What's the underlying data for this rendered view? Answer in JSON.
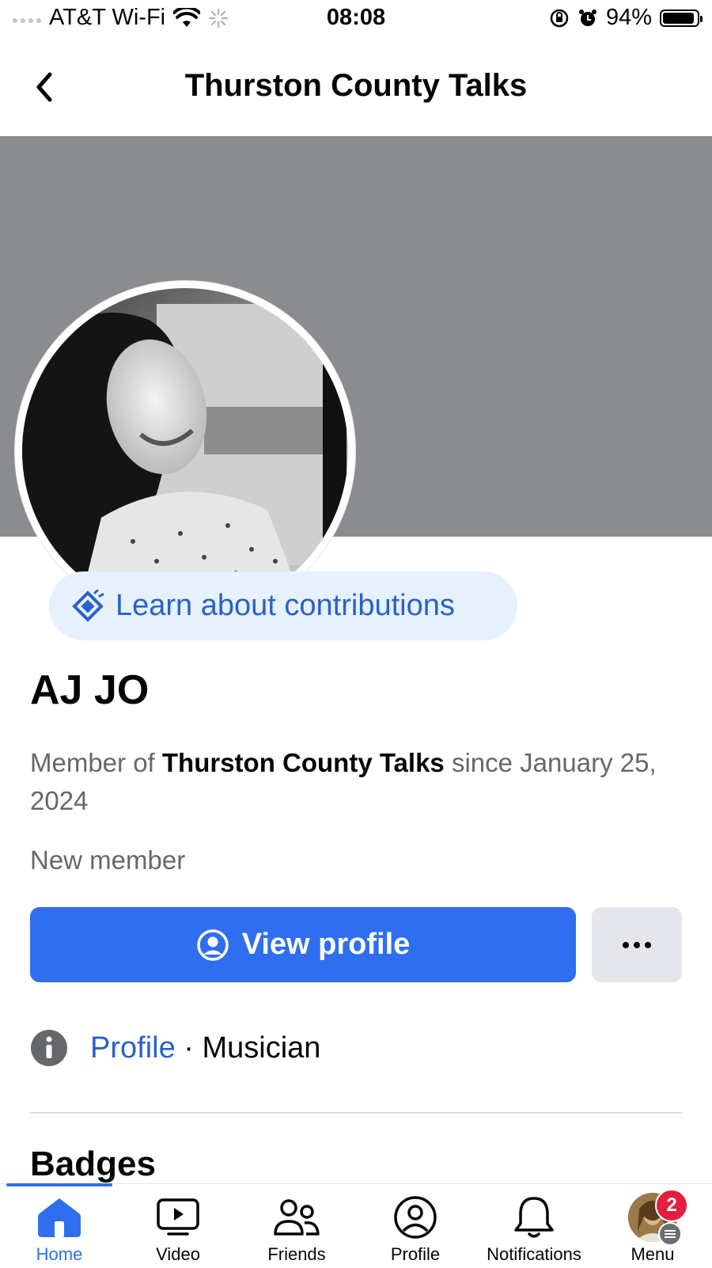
{
  "status_bar": {
    "carrier": "AT&T Wi-Fi",
    "time": "08:08",
    "battery": "94%",
    "battery_level": 0.94
  },
  "header": {
    "title": "Thurston County Talks"
  },
  "contribution_chip": {
    "label": "Learn about contributions"
  },
  "member": {
    "name": "AJ JO",
    "member_prefix": "Member of ",
    "group_name": "Thurston County Talks",
    "member_suffix": " since January 25, 2024",
    "status": "New member"
  },
  "actions": {
    "view_profile_label": "View profile",
    "more_label": "•••"
  },
  "info": {
    "profile_link": "Profile",
    "separator": "·",
    "occupation": "Musician"
  },
  "sections": {
    "badges_title": "Badges"
  },
  "tabbar": {
    "tabs": [
      {
        "label": "Home",
        "icon": "home-icon",
        "active": true
      },
      {
        "label": "Video",
        "icon": "video-icon"
      },
      {
        "label": "Friends",
        "icon": "friends-icon"
      },
      {
        "label": "Profile",
        "icon": "profile-icon"
      },
      {
        "label": "Notifications",
        "icon": "bell-icon"
      },
      {
        "label": "Menu",
        "icon": "menu-avatar",
        "badge": "2"
      }
    ]
  },
  "colors": {
    "accent": "#2f6eef",
    "link": "#2a62c7",
    "chip_bg": "#e7f0fd",
    "cover": "#8a8c90",
    "badge": "#e41e3f"
  }
}
